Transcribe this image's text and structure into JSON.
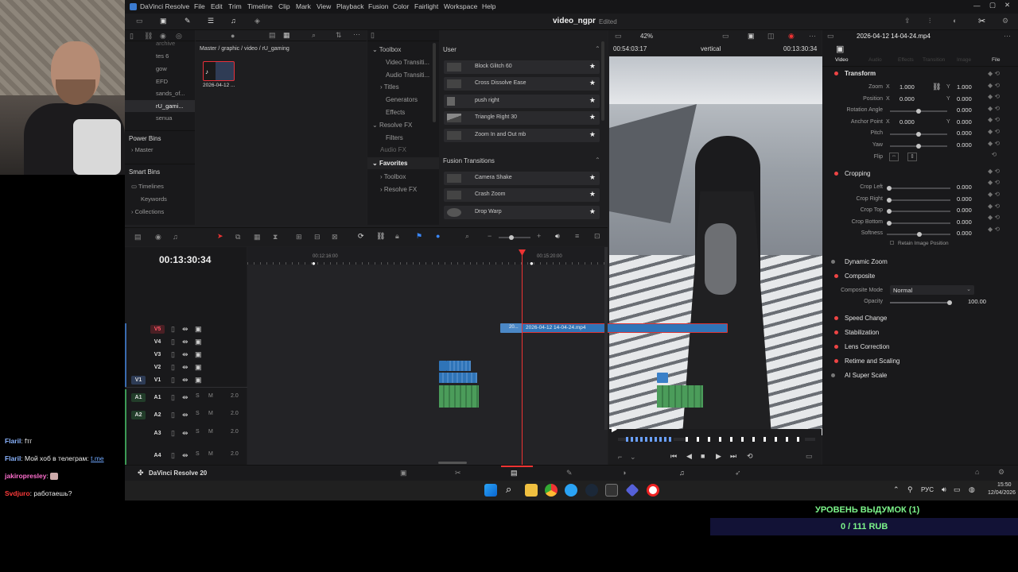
{
  "app": {
    "title": "DaVinci Resolve",
    "project": "video_ngpr",
    "status": "Edited",
    "brand": "DaVinci Resolve 20"
  },
  "menu": [
    "File",
    "Edit",
    "Trim",
    "Timeline",
    "Clip",
    "Mark",
    "View",
    "Playback",
    "Fusion",
    "Color",
    "Fairlight",
    "Workspace",
    "Help"
  ],
  "media": {
    "breadcrumb": "Master / graphic / video / rU_gaming",
    "bins": [
      "archive",
      "tes 6",
      "gow",
      "EFD",
      "sands_of...",
      "rU_gami...",
      "senua"
    ],
    "power_bins": "Power Bins",
    "master": "Master",
    "smart_bins": "Smart Bins",
    "smart": [
      "Timelines",
      "Keywords",
      "Collections"
    ],
    "clip_name": "2026-04-12 ..."
  },
  "effects": {
    "toolbox": "Toolbox",
    "tree": [
      "Video Transiti...",
      "Audio Transiti...",
      "Titles",
      "Generators",
      "Effects",
      "Resolve FX",
      "Filters",
      "Audio FX"
    ],
    "favorites": "Favorites",
    "fav_tree": [
      "Toolbox",
      "Resolve FX"
    ],
    "user_header": "User",
    "user_items": [
      "Block Glitch 60",
      "Cross Dissolve Ease",
      "push right",
      "Triangle Right 30",
      "Zoom In and Out mb"
    ],
    "fusion_header": "Fusion Transitions",
    "fusion_items": [
      "Camera Shake",
      "Crash Zoom",
      "Drop Warp"
    ]
  },
  "viewer": {
    "zoom": "42%",
    "timecode_left": "00:54:03:17",
    "mode": "vertical",
    "timecode_right": "00:13:30:34",
    "clip_title": "2026-04-12 14-04-24.mp4"
  },
  "inspector": {
    "tabs": [
      "Video",
      "Audio",
      "Effects",
      "Transition",
      "Image",
      "File"
    ],
    "transform": "Transform",
    "zoom_label": "Zoom",
    "zoom_x": "1.000",
    "zoom_y": "1.000",
    "position_label": "Position",
    "pos_x": "0.000",
    "pos_y": "0.000",
    "rotation_label": "Rotation Angle",
    "rotation": "0.000",
    "anchor_label": "Anchor Point",
    "anchor_x": "0.000",
    "anchor_y": "0.000",
    "pitch_label": "Pitch",
    "pitch": "0.000",
    "yaw_label": "Yaw",
    "yaw": "0.000",
    "flip_label": "Flip",
    "cropping": "Cropping",
    "crop_left_label": "Crop Left",
    "crop_left": "0.000",
    "crop_right_label": "Crop Right",
    "crop_right": "0.000",
    "crop_top_label": "Crop Top",
    "crop_top": "0.000",
    "crop_bottom_label": "Crop Bottom",
    "crop_bottom": "0.000",
    "softness_label": "Softness",
    "softness": "0.000",
    "retain": "Retain Image Position",
    "dynamic_zoom": "Dynamic Zoom",
    "composite": "Composite",
    "composite_mode_label": "Composite Mode",
    "composite_mode": "Normal",
    "opacity_label": "Opacity",
    "opacity": "100.00",
    "speed_change": "Speed Change",
    "stabilization": "Stabilization",
    "lens_correction": "Lens Correction",
    "retime": "Retime and Scaling",
    "super_scale": "AI Super Scale"
  },
  "timeline": {
    "timecode": "00:13:30:34",
    "ruler": [
      "00:12:16:00",
      "00:15:20:00"
    ],
    "video_tracks": [
      "V5",
      "V4",
      "V3",
      "V2",
      "V1"
    ],
    "audio_tracks": [
      "A1",
      "A2",
      "A3",
      "A4"
    ],
    "audio_levels": [
      "2.0",
      "2.0",
      "2.0",
      "2.0"
    ],
    "clip_short": "20...",
    "clip_label": "2026-04-12 14-04-24.mp4",
    "solo": "S",
    "mute": "M"
  },
  "taskbar": {
    "lang": "РУС",
    "time": "15:50",
    "date": "12/04/2026"
  },
  "chat": [
    {
      "nick": "Flaril",
      "color": "#8ab4ff",
      "text": "fтг"
    },
    {
      "nick": "Flaril",
      "color": "#8ab4ff",
      "text": "Мой хоб в телеграм: ",
      "link": "t.me"
    },
    {
      "nick": "jakiropresley",
      "color": "#ff6fcf",
      "text": ""
    },
    {
      "nick": "Svdjuro",
      "color": "#ff3b3b",
      "text": "работаешь?"
    }
  ],
  "donation": {
    "goal": "УРОВЕНЬ ВЫДУМОК (1)",
    "amount": "0 / 111 RUB"
  },
  "colors": {
    "accent_red": "#e44",
    "clip_blue": "#2f74b8",
    "audio_green": "#4b9c5a",
    "donation_green": "#7cf58a"
  }
}
